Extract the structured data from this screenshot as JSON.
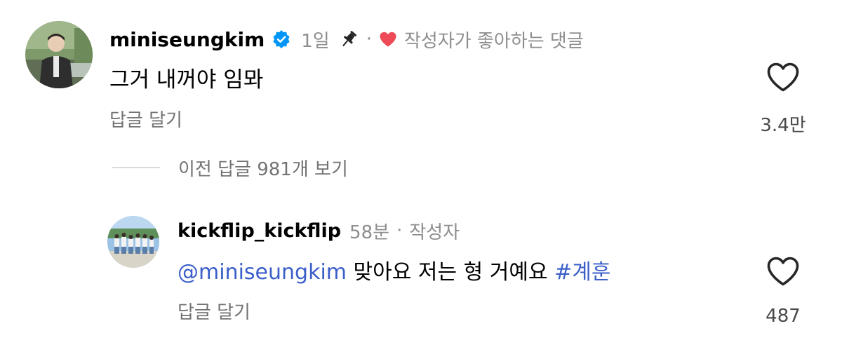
{
  "main_comment": {
    "username": "miniseungkim",
    "verified_icon": "verified-badge-icon",
    "time": "1일",
    "pin_icon": "pin-icon",
    "separator": "·",
    "liked_by_author_icon": "heart-filled-icon",
    "liked_by_author": "작성자가 좋아하는 댓글",
    "text": "그거 내꺼야 임뫄",
    "reply_label": "답글 달기",
    "like_icon": "heart-outline-icon",
    "like_count": "3.4만"
  },
  "view_replies": {
    "label": "이전 답글 981개 보기"
  },
  "reply_comment": {
    "username": "kickflip_kickflip",
    "time": "58분",
    "separator": "·",
    "author_label": "작성자",
    "mention": "@miniseungkim",
    "text": "맞아요 저는 형 거예요",
    "hashtag": "#계훈",
    "reply_label": "답글 달기",
    "like_icon": "heart-outline-icon",
    "like_count": "487"
  },
  "colors": {
    "verified_blue": "#0095f6",
    "heart_red": "#ed4956",
    "link_blue": "#3b5fc9",
    "secondary_text": "#737373",
    "meta_text": "#8e8e8e"
  }
}
